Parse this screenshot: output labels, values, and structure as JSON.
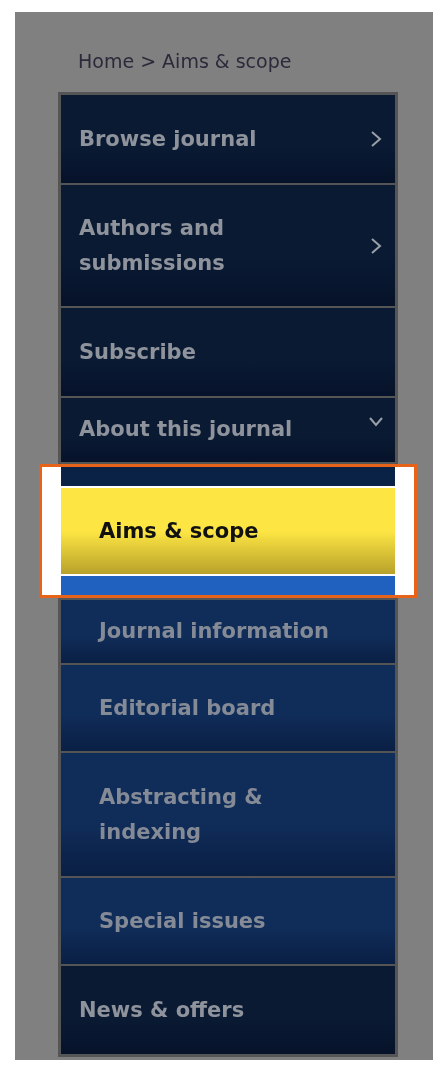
{
  "breadcrumb": "Home > Aims & scope",
  "menu": [
    {
      "label": "Browse journal",
      "kind": "submenu"
    },
    {
      "label": "Authors and submissions",
      "kind": "submenu"
    },
    {
      "label": "Subscribe",
      "kind": "link"
    },
    {
      "label": "About this journal",
      "kind": "section",
      "expanded": true,
      "children": [
        {
          "label": "Aims & scope",
          "selected": true
        },
        {
          "label": "Journal information",
          "selected": false
        },
        {
          "label": "Editorial board",
          "selected": false
        },
        {
          "label": "Abstracting & indexing",
          "selected": false
        },
        {
          "label": "Special issues",
          "selected": false
        }
      ]
    },
    {
      "label": "News & offers",
      "kind": "link"
    }
  ]
}
